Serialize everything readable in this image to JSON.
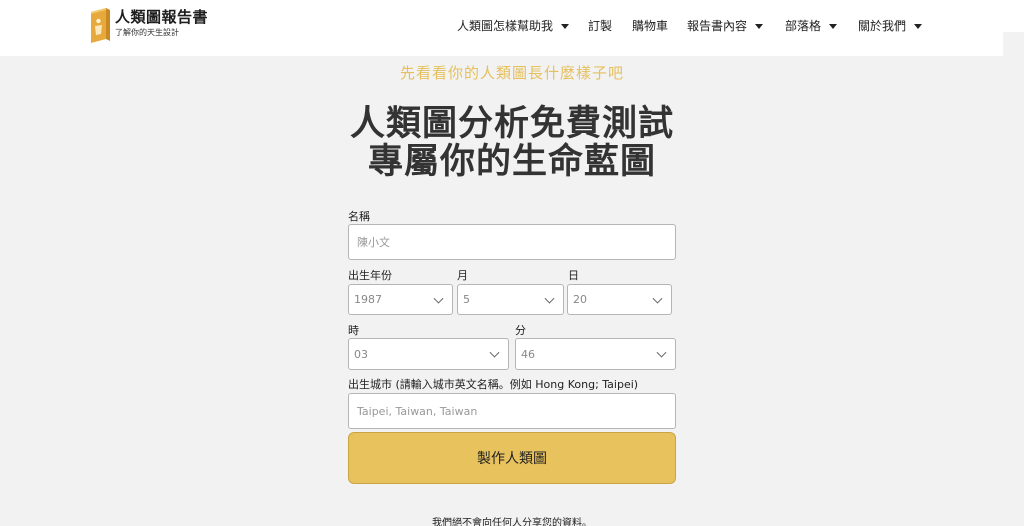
{
  "brand": {
    "name": "人類圖報告書",
    "tagline": "了解你的天生設計"
  },
  "nav": {
    "items": [
      {
        "label": "人類圖怎樣幫助我",
        "has_dropdown": true
      },
      {
        "label": "訂製",
        "has_dropdown": false
      },
      {
        "label": "購物車",
        "has_dropdown": false
      },
      {
        "label": "報告書內容",
        "has_dropdown": true
      },
      {
        "label": "部落格",
        "has_dropdown": true
      },
      {
        "label": "關於我們",
        "has_dropdown": true
      }
    ]
  },
  "hero": {
    "subtitle": "先看看你的人類圖長什麼樣子吧",
    "title_line1": "人類圖分析免費測試",
    "title_line2": "專屬你的生命藍圖"
  },
  "form": {
    "name_label": "名稱",
    "name_placeholder": "陳小文",
    "year_label": "出生年份",
    "year_value": "1987",
    "month_label": "月",
    "month_value": "5",
    "day_label": "日",
    "day_value": "20",
    "hour_label": "時",
    "hour_value": "03",
    "minute_label": "分",
    "minute_value": "46",
    "city_label": "出生城市 (請輸入城市英文名稱。例如 Hong Kong; Taipei)",
    "city_placeholder": "Taipei, Taiwan, Taiwan",
    "submit_label": "製作人類圖"
  },
  "privacy_note": "我們絕不會向任何人分享您的資料。",
  "colors": {
    "accent": "#e8c25c",
    "subtitle": "#e6c05c",
    "background": "#f2f2f2",
    "header": "#ffffff"
  }
}
